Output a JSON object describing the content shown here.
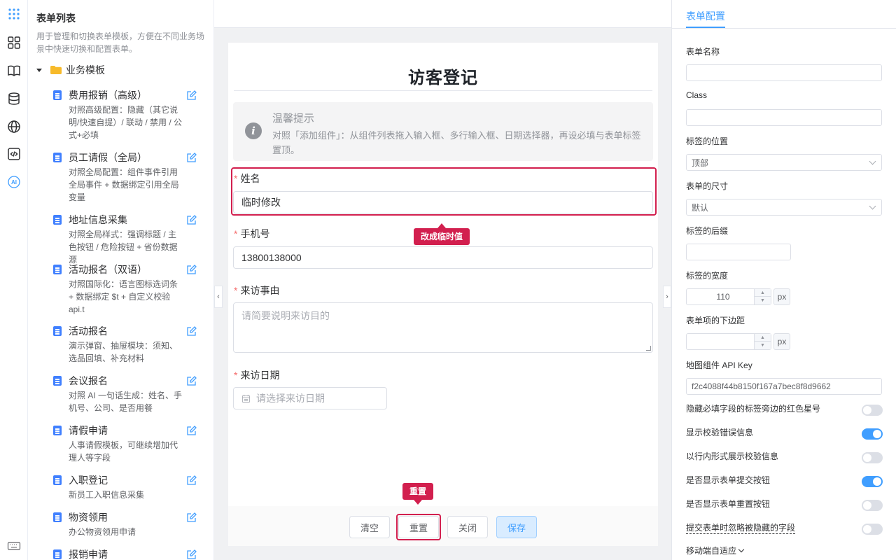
{
  "sidebar": {
    "title": "表单列表",
    "description": "用于管理和切换表单模板，方便在不同业务场景中快速切换和配置表单。",
    "group": "业务模板",
    "templates": [
      {
        "name": "费用报销（高级）",
        "desc": "对照高级配置：隐藏（其它说明/快速自提）/ 联动 / 禁用 / 公式+必填"
      },
      {
        "name": "员工请假（全局）",
        "desc": "对照全局配置：组件事件引用全局事件 + 数据绑定引用全局变量"
      },
      {
        "name": "地址信息采集",
        "desc": "对照全局样式：强调标题 / 主色按钮 / 危险按钮 + 省份数据源"
      },
      {
        "name": "活动报名（双语）",
        "desc": "对照国际化：语言图标选词条 + 数据绑定 $t + 自定义校验 api.t"
      },
      {
        "name": "活动报名",
        "desc": "演示弹窗、抽屉模块：须知、选品回填、补充材料"
      },
      {
        "name": "会议报名",
        "desc": "对照 AI 一句话生成：姓名、手机号、公司、是否用餐"
      },
      {
        "name": "请假申请",
        "desc": "人事请假模板，可继续增加代理人等字段"
      },
      {
        "name": "入职登记",
        "desc": "新员工入职信息采集"
      },
      {
        "name": "物资领用",
        "desc": "办公物资领用申请"
      },
      {
        "name": "报销申请",
        "desc": ""
      }
    ]
  },
  "form": {
    "title": "访客登记",
    "alert": {
      "title": "温馨提示",
      "text": "对照「添加组件」：从组件列表拖入输入框、多行输入框、日期选择器，再设必填与表单标签置顶。"
    },
    "fields": {
      "name": {
        "label": "姓名",
        "value": "临时修改"
      },
      "phone": {
        "label": "手机号",
        "value": "13800138000"
      },
      "reason": {
        "label": "来访事由",
        "placeholder": "请简要说明来访目的"
      },
      "date": {
        "label": "来访日期",
        "placeholder": "请选择来访日期"
      }
    },
    "required_mark": "*",
    "buttons": {
      "clear": "清空",
      "reset": "重置",
      "close": "关闭",
      "save": "保存"
    }
  },
  "annotations": {
    "name_callout": "改成临时值",
    "reset_callout": "重置"
  },
  "panel": {
    "tab": "表单配置",
    "form_name_label": "表单名称",
    "form_name_value": "",
    "class_label": "Class",
    "class_value": "",
    "label_position_label": "标签的位置",
    "label_position_value": "顶部",
    "form_size_label": "表单的尺寸",
    "form_size_value": "默认",
    "label_suffix_label": "标签的后缀",
    "label_suffix_value": "",
    "label_width_label": "标签的宽度",
    "label_width_value": "110",
    "label_width_unit": "px",
    "item_margin_label": "表单项的下边距",
    "item_margin_value": "",
    "item_margin_unit": "px",
    "map_key_label": "地图组件 API Key",
    "map_key_value": "f2c4088f44b8150f167a7bec8f8d9662",
    "switches": [
      {
        "label": "隐藏必填字段的标签旁边的红色星号",
        "on": false
      },
      {
        "label": "显示校验错误信息",
        "on": true
      },
      {
        "label": "以行内形式展示校验信息",
        "on": false
      },
      {
        "label": "是否显示表单提交按钮",
        "on": true
      },
      {
        "label": "是否显示表单重置按钮",
        "on": false
      },
      {
        "label": "提交表单时忽略被隐藏的字段",
        "on": false
      }
    ],
    "mobile_label": "移动端自适应"
  },
  "colors": {
    "accent": "#409eff",
    "annotation": "#d21f4e",
    "required": "#f56c6c",
    "doc_icon": "#4080ff",
    "folder": "#f7ba2a"
  },
  "icons": {
    "rail": [
      "apps-grid-icon",
      "components-icon",
      "book-icon",
      "database-icon",
      "globe-icon",
      "code-icon",
      "ai-icon",
      "keyboard-icon"
    ]
  }
}
